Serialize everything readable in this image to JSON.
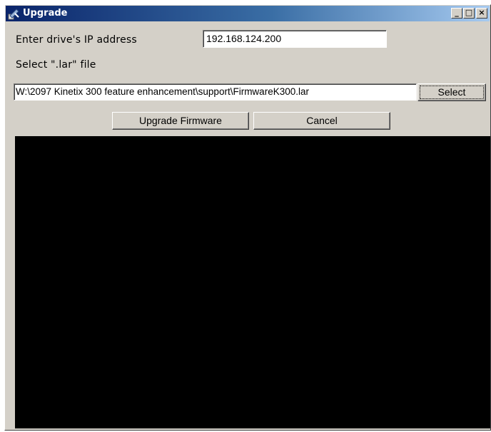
{
  "window": {
    "title": "Upgrade",
    "minimize_glyph": "_",
    "maximize_glyph": "□",
    "close_glyph": "×"
  },
  "form": {
    "ip_label": "Enter drive's IP address",
    "ip_value": "192.168.124.200",
    "file_label": "Select \".lar\" file",
    "file_value": "W:\\2097 Kinetix 300 feature enhancement\\support\\FirmwareK300.lar",
    "select_button": "Select",
    "upgrade_button": "Upgrade Firmware",
    "cancel_button": "Cancel"
  },
  "colors": {
    "window_bg": "#d4d0c8",
    "title_gradient_start": "#0a246a",
    "title_gradient_end": "#a6caf0",
    "console_bg": "#000000"
  }
}
